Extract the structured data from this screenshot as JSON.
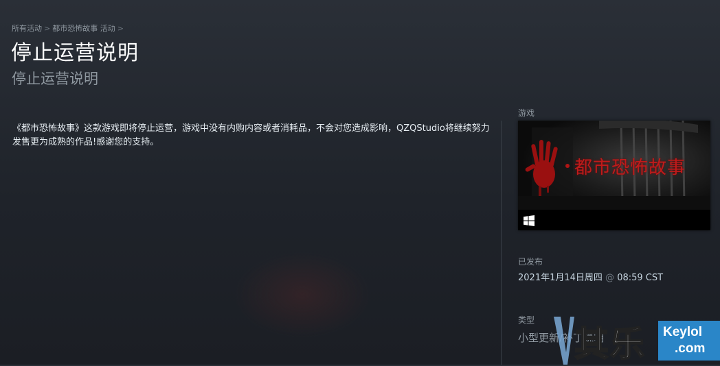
{
  "breadcrumb": {
    "items": [
      "所有活动",
      "都市恐怖故事 活动"
    ],
    "separator": ">"
  },
  "header": {
    "title": "停止运营说明",
    "subtitle": "停止运营说明"
  },
  "content": {
    "paragraph": "《都市恐怖故事》这款游戏即将停止运营，游戏中没有内购内容或者消耗品，不会对您造成影响，QZQStudio将继续努力发售更为成熟的作品!感谢您的支持。"
  },
  "sidebar": {
    "game_label": "游戏",
    "game_card": {
      "capsule_title": "都市恐怖故事",
      "platform_icon": "windows-icon"
    },
    "released_label": "已发布",
    "released_date": "2021年1月14日周四",
    "released_at": "@",
    "released_time": "08:59 CST",
    "type_label": "类型",
    "type_value": "小型更新/补丁说明"
  },
  "watermark": {
    "text_cn": "其乐",
    "brand_line1": "Keylol",
    "brand_line2": ".com"
  },
  "colors": {
    "background": "#1f232a",
    "title": "#ffffff",
    "muted": "#8f98a0",
    "capsule_red": "#c01b1b",
    "watermark_blue": "#2a86c8"
  }
}
